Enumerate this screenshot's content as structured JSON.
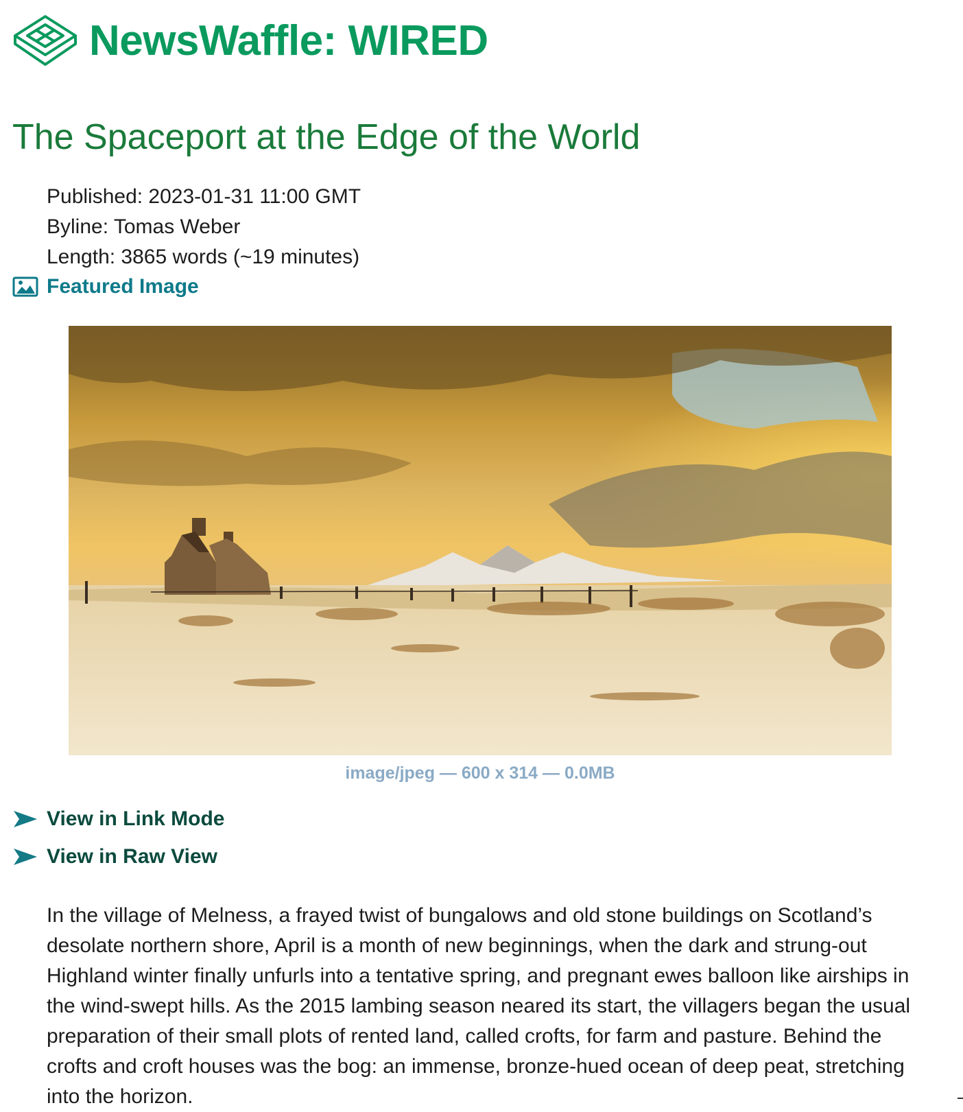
{
  "header": {
    "site_title": "NewsWaffle: WIRED",
    "logo_icon": "waffle-logo-icon",
    "brand_color": "#0a9a5e"
  },
  "article": {
    "title": "The Spaceport at the Edge of the World",
    "published": "Published: 2023-01-31 11:00 GMT",
    "byline": "Byline: Tomas Weber",
    "length": "Length: 3865 words (~19 minutes)",
    "title_color": "#1a7a3a"
  },
  "featured_image": {
    "label": "Featured Image",
    "icon": "image-icon",
    "caption": "image/jpeg — 600 x 314 — 0.0MB"
  },
  "links": [
    {
      "label": "View in Link Mode",
      "icon": "arrow-right-icon"
    },
    {
      "label": "View in Raw View",
      "icon": "arrow-right-icon"
    }
  ],
  "body": {
    "paragraph": "In the village of Melness, a frayed twist of bungalows and old stone buildings on Scotland’s desolate northern shore, April is a month of new beginnings, when the dark and strung-out Highland winter finally unfurls into a tentative spring, and pregnant ewes balloon like airships in the wind-swept hills. As the 2015 lambing season neared its start, the villagers began the usual preparation of their small plots of rented land, called crofts, for farm and pasture. Behind the crofts and croft houses was the bog: an immense, bronze-hued ocean of deep peat, stretching into the horizon."
  }
}
